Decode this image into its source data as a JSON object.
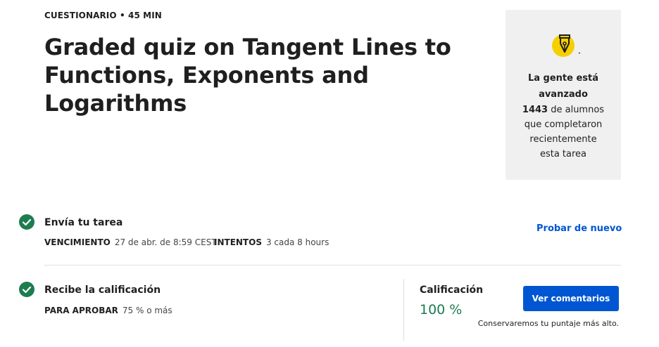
{
  "header": {
    "meta": "CUESTIONARIO • 45 MIN",
    "title": "Graded quiz on Tangent Lines to Functions, Exponents and Logarithms"
  },
  "progress_card": {
    "heading_line1": "La gente está",
    "heading_line2": "avanzado",
    "count": "1443",
    "text_after_count": "de alumnos",
    "text_line2": "que completaron",
    "text_line3": "recientemente",
    "text_line4": "esta tarea",
    "badge_icon": "pen-nib-icon",
    "badge_color": "#f5d000"
  },
  "steps": {
    "submit": {
      "title": "Envía tu tarea",
      "due_label": "VENCIMIENTO",
      "due_value": "27 de abr. de 8:59 CEST",
      "attempts_label": "INTENTOS",
      "attempts_value": "3 cada 8 hours",
      "retry_link": "Probar de nuevo"
    },
    "grade": {
      "title": "Recibe la calificación",
      "pass_label": "PARA APROBAR",
      "pass_value": "75 % o más",
      "grade_label": "Calificación",
      "grade_value": "100 %",
      "feedback_button": "Ver comentarios",
      "keep_note": "Conservaremos tu puntaje más alto."
    }
  },
  "colors": {
    "check_green": "#1d7c50",
    "link_blue": "#0056d2",
    "grade_green": "#1d7c50"
  }
}
